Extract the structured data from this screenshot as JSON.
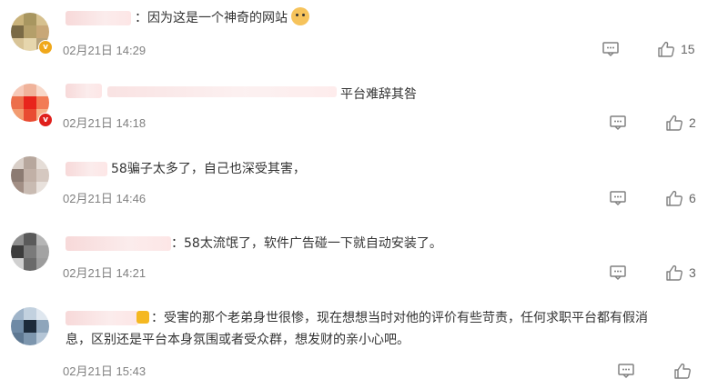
{
  "comments": [
    {
      "colon": "：",
      "text": "因为这是一个神奇的网站",
      "emoji": "doge-icon",
      "time": "02月21日 14:29",
      "likes": "15"
    },
    {
      "text": "平台难辞其咎",
      "time": "02月21日 14:18",
      "likes": "2"
    },
    {
      "text": "58骗子太多了，自己也深受其害，",
      "time": "02月21日 14:46",
      "likes": "6"
    },
    {
      "colon": "：",
      "text": "58太流氓了，软件广告碰一下就自动安装了。",
      "time": "02月21日 14:21",
      "likes": "3"
    },
    {
      "colon": "：",
      "text": "受害的那个老弟身世很惨，现在想想当时对他的评价有些苛责，任何求职平台都有假消息，区别还是平台本身氛围或者受众群，想发财的亲小心吧。",
      "time": "02月21日 15:43"
    }
  ],
  "colors": {
    "text": "#333333",
    "time": "#808080",
    "icon": "#808080",
    "gold_badge": "#f0a81b",
    "red_badge": "#e0201c"
  }
}
